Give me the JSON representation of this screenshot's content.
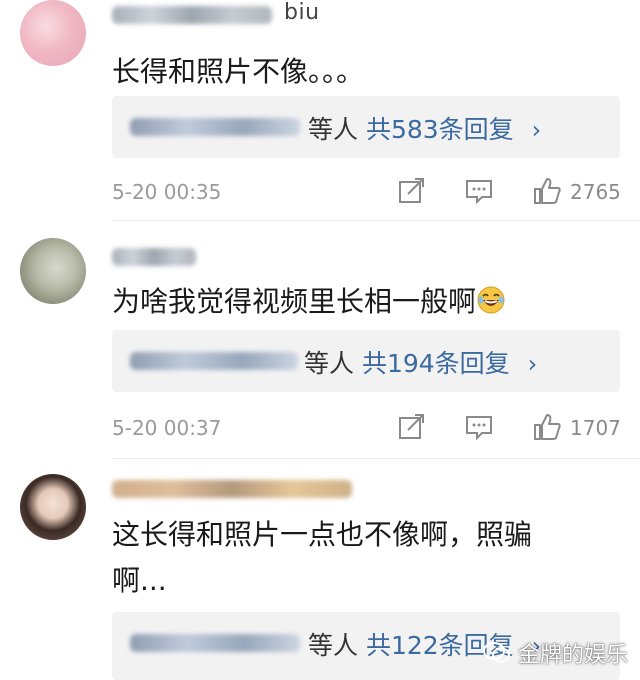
{
  "comments": [
    {
      "name_visible": "biu",
      "text": "长得和照片不像。。。",
      "reply_suffix": "等人",
      "reply_count": "共583条回复",
      "time": "5-20 00:35",
      "likes": "2765"
    },
    {
      "name_visible": "",
      "text": "为啥我觉得视频里长相一般啊",
      "reply_suffix": "等人",
      "reply_count": "共194条回复",
      "time": "5-20 00:37",
      "likes": "1707"
    },
    {
      "name_visible": "",
      "text_line1": "这长得和照片一点也不像啊，照骗",
      "text_line2": "啊...",
      "reply_suffix": "等人",
      "reply_count": "共122条回复",
      "time": "",
      "likes": ""
    }
  ],
  "watermark": {
    "text": "金牌的娱乐"
  },
  "colors": {
    "link": "#3a6aa0",
    "reply_bg": "#f2f2f2",
    "meta": "#9a9a9a"
  },
  "icons": [
    "share-icon",
    "comment-icon",
    "like-icon",
    "laughing-emoji",
    "wechat-watermark-icon"
  ]
}
